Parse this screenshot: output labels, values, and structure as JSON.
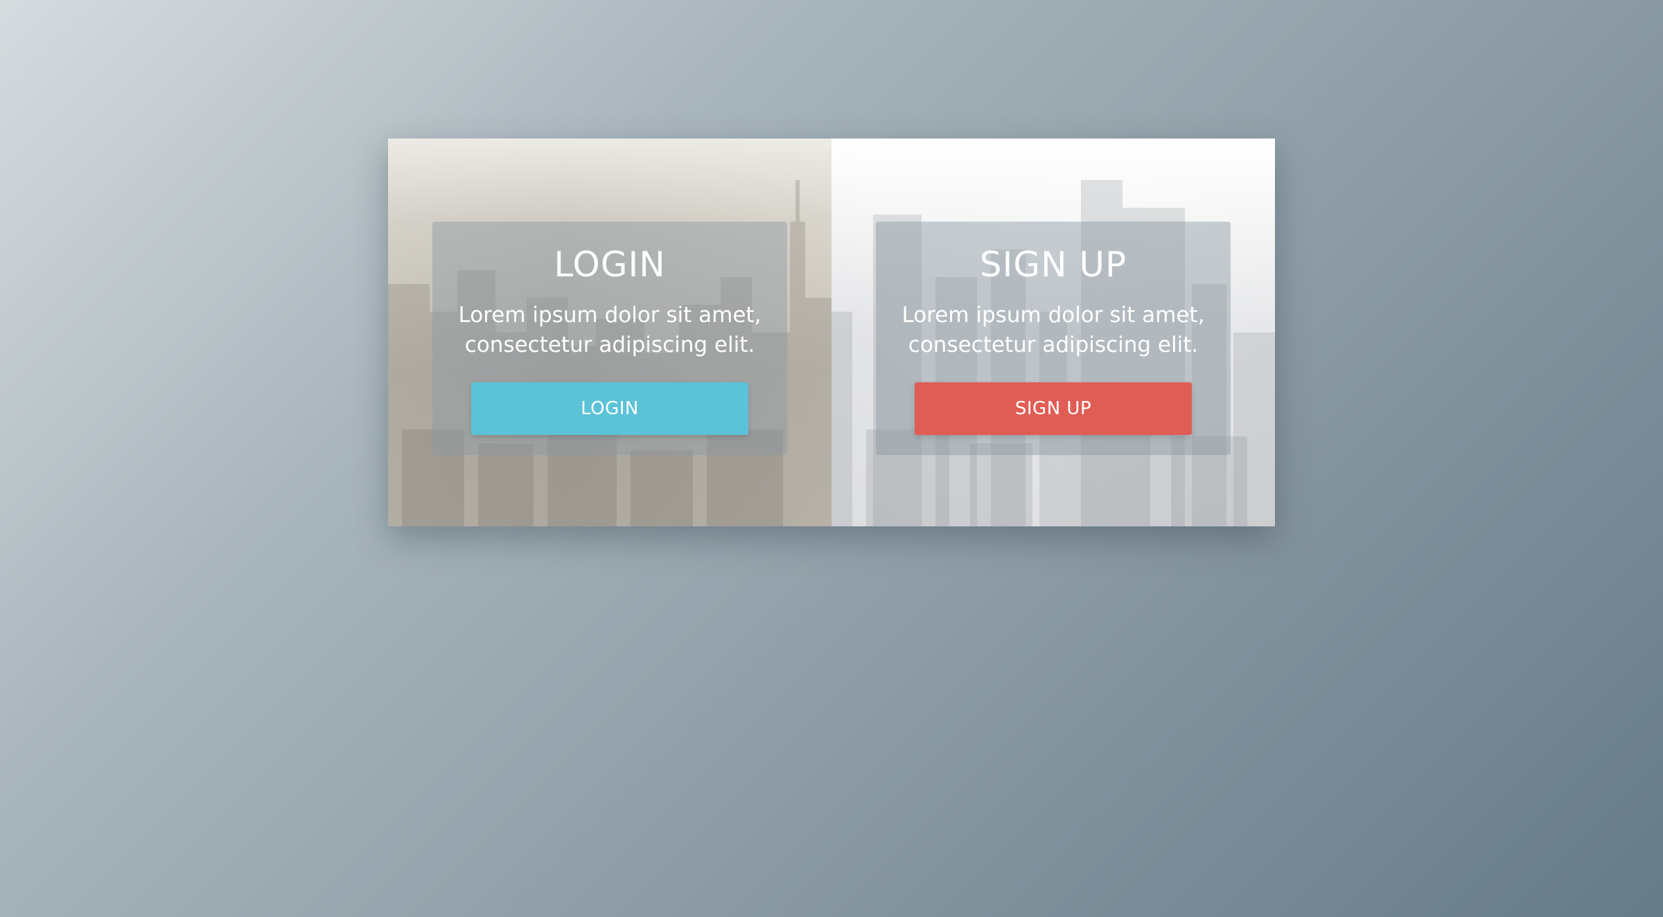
{
  "login": {
    "title": "LOGIN",
    "text": "Lorem ipsum dolor sit amet, consectetur adipiscing elit.",
    "button_label": "LOGIN",
    "button_color": "#5bc2d8"
  },
  "signup": {
    "title": "SIGN UP",
    "text": "Lorem ipsum dolor sit amet, consectetur adipiscing elit.",
    "button_label": "SIGN UP",
    "button_color": "#e05d56"
  }
}
